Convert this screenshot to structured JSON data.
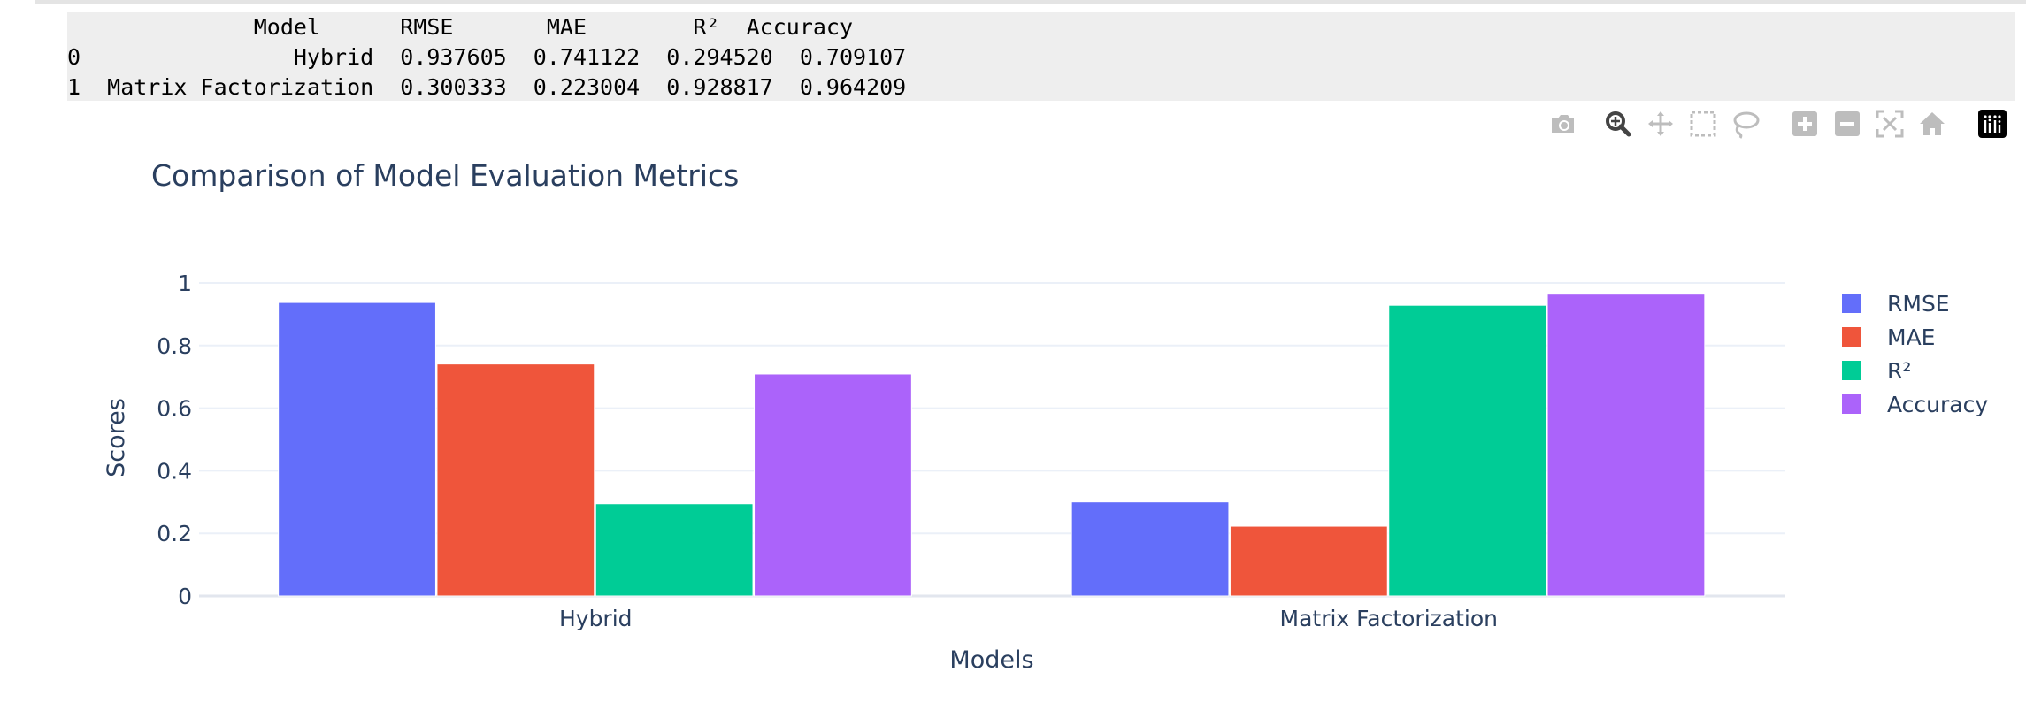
{
  "dataframe": {
    "header": "              Model      RMSE       MAE        R²  Accuracy",
    "rows": [
      "0                Hybrid  0.937605  0.741122  0.294520  0.709107",
      "1  Matrix Factorization  0.300333  0.223004  0.928817  0.964209"
    ]
  },
  "modebar": {
    "buttons": [
      {
        "name": "camera-icon",
        "title": "Download plot as a png"
      },
      {
        "name": "zoom-icon",
        "title": "Zoom"
      },
      {
        "name": "pan-icon",
        "title": "Pan"
      },
      {
        "name": "box-select-icon",
        "title": "Box Select"
      },
      {
        "name": "lasso-select-icon",
        "title": "Lasso Select"
      },
      {
        "name": "zoom-in-icon",
        "title": "Zoom in"
      },
      {
        "name": "zoom-out-icon",
        "title": "Zoom out"
      },
      {
        "name": "autoscale-icon",
        "title": "Autoscale"
      },
      {
        "name": "reset-axes-icon",
        "title": "Reset axes"
      },
      {
        "name": "plotly-logo-icon",
        "title": "Produced with Plotly"
      }
    ]
  },
  "chart_data": {
    "type": "bar",
    "title": "Comparison of Model Evaluation Metrics",
    "xlabel": "Models",
    "ylabel": "Scores",
    "categories": [
      "Hybrid",
      "Matrix Factorization"
    ],
    "series": [
      {
        "name": "RMSE",
        "values": [
          0.937605,
          0.300333
        ],
        "color": "#636efa"
      },
      {
        "name": "MAE",
        "values": [
          0.741122,
          0.223004
        ],
        "color": "#ef553b"
      },
      {
        "name": "R²",
        "values": [
          0.29452,
          0.928817
        ],
        "color": "#00cc96"
      },
      {
        "name": "Accuracy",
        "values": [
          0.709107,
          0.964209
        ],
        "color": "#ab63fa"
      }
    ],
    "ylim": [
      0,
      1.0
    ],
    "yticks": [
      "0",
      "0.2",
      "0.4",
      "0.6",
      "0.8",
      "1"
    ],
    "grid": true,
    "legend_position": "right",
    "colors": {
      "text": "#2a3f5f",
      "grid": "#ebf0f8",
      "background": "#ffffff"
    }
  }
}
